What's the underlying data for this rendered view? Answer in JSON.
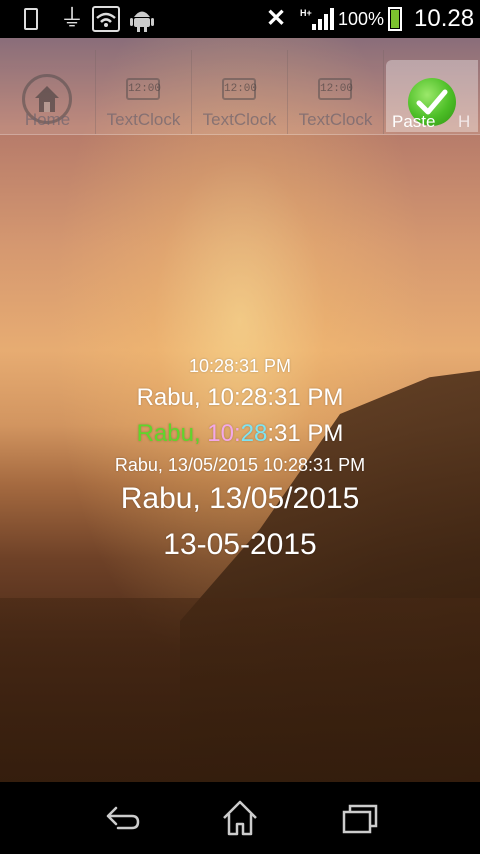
{
  "status_bar": {
    "battery_percent": "100%",
    "network": "H+",
    "time": "10.28",
    "battery_level": 1.0
  },
  "tabs": [
    {
      "label": "Home",
      "icon": "home-icon",
      "selected": false
    },
    {
      "label": "TextClock",
      "icon": "clock-icon",
      "icon_text": "12:00",
      "selected": false
    },
    {
      "label": "TextClock",
      "icon": "clock-icon",
      "icon_text": "12:00",
      "selected": false
    },
    {
      "label": "TextClock",
      "icon": "clock-icon",
      "icon_text": "12:00",
      "selected": false
    },
    {
      "label": "Paste",
      "icon": "check-icon",
      "selected": true
    },
    {
      "label": "H",
      "icon": "",
      "selected": false
    }
  ],
  "clocks": {
    "line1": "10:28:31 PM",
    "line2": "Rabu, 10:28:31 PM",
    "line3": {
      "day": "Rabu,",
      "hour": "10",
      "sep": ":",
      "minute": "28",
      "rest": ":31 PM"
    },
    "line4": "Rabu, 13/05/2015 10:28:31 PM",
    "line5": "Rabu, 13/05/2015",
    "line6": "13-05-2015"
  },
  "colors": {
    "day_green": "#5fd62c",
    "hour_pink": "#f3a8e8",
    "minute_cyan": "#7de3f2",
    "check_green": "#4cbe26"
  }
}
